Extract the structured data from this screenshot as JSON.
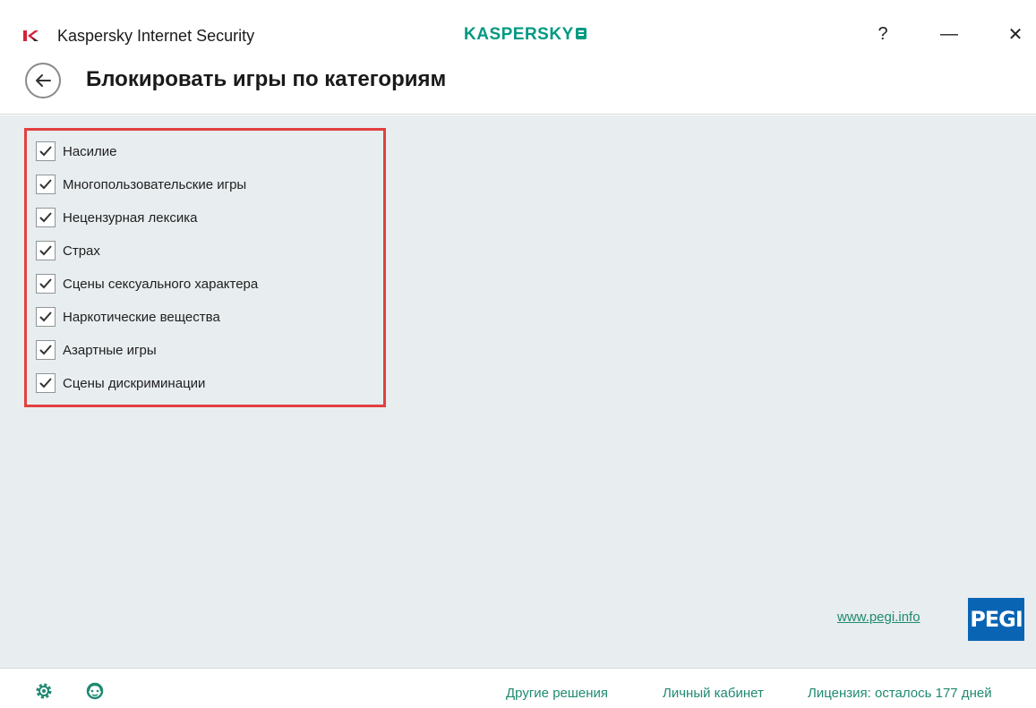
{
  "app": {
    "title": "Kaspersky Internet Security",
    "brand": "KASPERSKY",
    "help_symbol": "?",
    "minimize_symbol": "—",
    "close_symbol": "✕"
  },
  "header": {
    "title": "Блокировать игры по категориям",
    "back_icon": "arrow-left-icon"
  },
  "categories": [
    {
      "label": "Насилие",
      "checked": true
    },
    {
      "label": "Многопользовательские игры",
      "checked": true
    },
    {
      "label": "Нецензурная лексика",
      "checked": true
    },
    {
      "label": "Страх",
      "checked": true
    },
    {
      "label": "Сцены сексуального характера",
      "checked": true
    },
    {
      "label": "Наркотические вещества",
      "checked": true
    },
    {
      "label": "Азартные игры",
      "checked": true
    },
    {
      "label": "Сцены дискриминации",
      "checked": true
    }
  ],
  "pegi": {
    "link": "www.pegi.info",
    "logo": "PEGI"
  },
  "footer": {
    "settings_icon": "gear-icon",
    "support_icon": "support-agent-icon",
    "other_solutions": "Другие решения",
    "personal_cabinet": "Личный кабинет",
    "license": "Лицензия: осталось 177 дней"
  },
  "colors": {
    "accent": "#009982",
    "link": "#1f8a71",
    "highlight_border": "#e2403f",
    "content_bg": "#e8edef",
    "pegi_blue": "#0a64b4"
  }
}
